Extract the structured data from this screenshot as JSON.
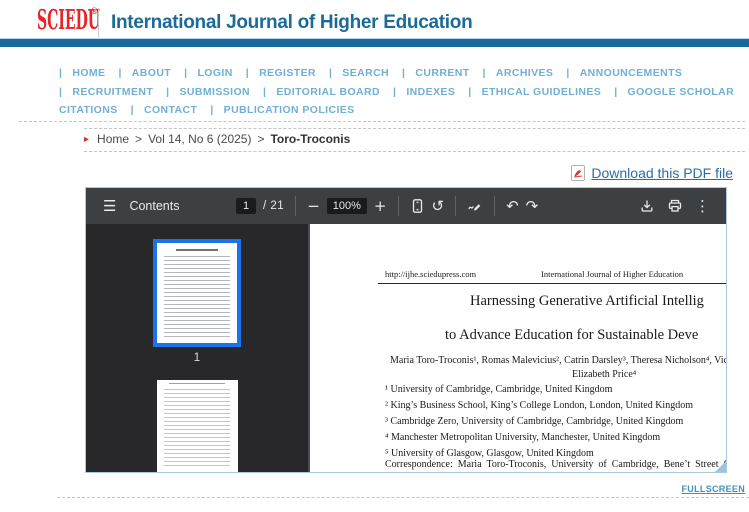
{
  "header": {
    "logo_text": "SCIEDU",
    "logo_reg": "®",
    "journal_title": "International Journal of Higher Education"
  },
  "nav": {
    "separator": "|",
    "lines": [
      {
        "lead_pipe": true,
        "items": [
          "HOME",
          "ABOUT",
          "LOGIN",
          "REGISTER",
          "SEARCH",
          "CURRENT",
          "ARCHIVES",
          "ANNOUNCEMENTS"
        ]
      },
      {
        "lead_pipe": true,
        "items": [
          "RECRUITMENT",
          "SUBMISSION",
          "EDITORIAL BOARD",
          "INDEXES",
          "ETHICAL GUIDELINES",
          "GOOGLE SCHOLAR"
        ]
      },
      {
        "lead_pipe": false,
        "items": [
          "CITATIONS",
          "CONTACT",
          "PUBLICATION POLICIES"
        ]
      }
    ]
  },
  "breadcrumb": {
    "marker": "▸",
    "separator": ">",
    "items": [
      "Home",
      "Vol 14, No 6 (2025)",
      "Toro-Troconis"
    ]
  },
  "download_link": {
    "label": "Download this PDF file"
  },
  "fullscreen_label": "FULLSCREEN",
  "pdf_viewer": {
    "toolbar": {
      "menu_icon": "☰",
      "contents_label": "Contents",
      "page_current": "1",
      "page_separator": "/",
      "page_total": "21",
      "zoom_out_icon": "−",
      "zoom_value": "100%",
      "zoom_in_icon": "+",
      "rotate_icon": "↺",
      "undo_icon": "↶",
      "redo_icon": "↷",
      "more_icon": "⋮"
    },
    "sidebar": {
      "thumbnails": [
        {
          "label": "1",
          "selected": true
        },
        {
          "label": "",
          "selected": false
        }
      ]
    },
    "page": {
      "header_url": "http://ijhe.sciedupress.com",
      "header_journal": "International Journal of Higher Education",
      "title_line1": "Harnessing Generative Artificial Intellig",
      "title_line2": "to Advance Education for Sustainable Deve",
      "authors_line1": "Maria Toro-Troconis¹, Romas Malevicius², Catrin Darsley³, Theresa Nicholson⁴, Vic",
      "authors_line2": "Elizabeth Price⁴",
      "affiliations": [
        "¹ University of Cambridge, Cambridge, United Kingdom",
        "² King’s Business School, King’s College London, London, United Kingdom",
        "³ Cambridge Zero, University of Cambridge, Cambridge, United Kingdom",
        "⁴ Manchester Metropolitan University, Manchester, United Kingdom",
        "⁵ University of Glasgow, Glasgow, United Kingdom"
      ],
      "correspondence": "Correspondence: Maria Toro-Troconis, University of Cambridge, Bene’t Street Ca"
    }
  },
  "colors": {
    "brand_red": "#e8232a",
    "journal_title_blue": "#1b6b98",
    "top_bar_blue": "#176b9a",
    "nav_link_blue": "#6fb0d4",
    "download_link_blue": "#2a6da8",
    "fullscreen_link_blue": "#3d93bd",
    "toolbar_bg": "#3c4043",
    "viewer_bg": "#28282b",
    "thumbnail_selected_blue": "#1a73e8",
    "breadcrumb_arrow_red": "#c9342c"
  }
}
